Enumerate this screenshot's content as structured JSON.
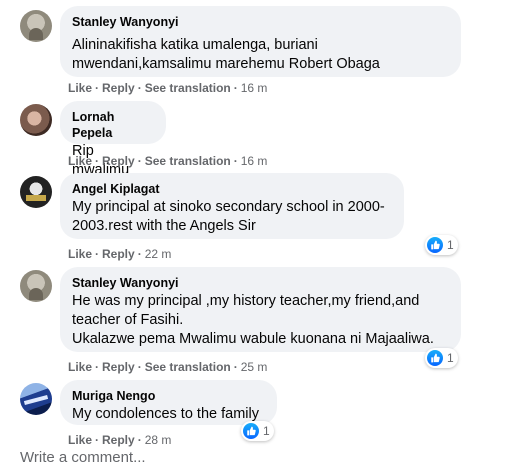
{
  "comments": [
    {
      "author": "Stanley Wanyonyi",
      "lines": [
        "Alininakifisha katika umalenga, buriani",
        "mwendani,kamsalimu marehemu Robert Obaga"
      ],
      "like": "Like",
      "reply": "Reply",
      "translate": "See translation",
      "time": "16 m"
    },
    {
      "author": "Lornah Pepela",
      "lines": [
        "Rip mwalimu"
      ],
      "like": "Like",
      "reply": "Reply",
      "translate": "See translation",
      "time": "16 m"
    },
    {
      "author": "Angel Kiplagat",
      "lines": [
        "My principal at sinoko secondary school in 2000-",
        "2003.rest with the Angels Sir"
      ],
      "like": "Like",
      "reply": "Reply",
      "time": "22 m",
      "reaction_count": "1"
    },
    {
      "author": "Stanley Wanyonyi",
      "lines": [
        "He was my principal ,my history teacher,my friend,and",
        "teacher of Fasihi.",
        "Ukalazwe pema Mwalimu wabule kuonana ni Majaaliwa."
      ],
      "like": "Like",
      "reply": "Reply",
      "translate": "See translation",
      "time": "25 m",
      "reaction_count": "1"
    },
    {
      "author": "Muriga Nengo",
      "lines": [
        "My condolences to the family"
      ],
      "like": "Like",
      "reply": "Reply",
      "time": "28 m",
      "reaction_count": "1"
    }
  ],
  "write_comment_placeholder": "Write a comment...",
  "colors": {
    "bubble": "#f0f2f5",
    "meta_text": "#65676b",
    "like_blue": "#0866ff"
  },
  "icons": {
    "reaction": "like-thumb-icon"
  }
}
